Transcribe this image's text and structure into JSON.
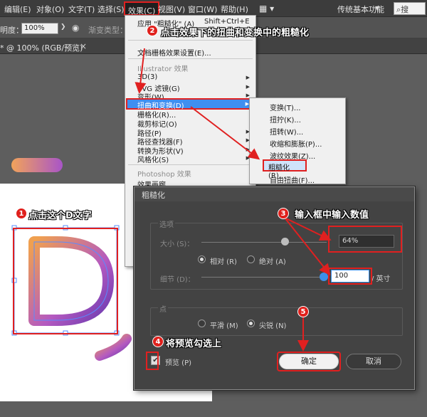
{
  "menubar": {
    "items": [
      {
        "label": "编辑(E)"
      },
      {
        "label": "对象(O)"
      },
      {
        "label": "文字(T)"
      },
      {
        "label": "选择(S)"
      },
      {
        "label": "效果(C)"
      },
      {
        "label": "视图(V)"
      },
      {
        "label": "窗口(W)"
      },
      {
        "label": "帮助(H)"
      }
    ],
    "workspace": "传统基本功能",
    "search_placeholder": "搜"
  },
  "control_bar": {
    "opacity_label": "明度：",
    "opacity_value": "100%",
    "gradient_label": "渐变类型："
  },
  "doc_tab": {
    "label": "* @ 100% (RGB/预览)",
    "close": "×"
  },
  "effect_menu": {
    "apply_label": "应用 \"粗糙化\" (A)",
    "apply_shortcut": "Shift+Ctrl+E",
    "raster_settings": "文档栅格效果设置(E)...",
    "illustrator_header": "Illustrator 效果",
    "items": [
      {
        "label": "3D(3)"
      },
      {
        "label": "SVG 滤镜(G)"
      },
      {
        "label": "变形(W)"
      },
      {
        "label": "扭曲和变换(D)"
      },
      {
        "label": "栅格化(R)..."
      },
      {
        "label": "裁剪标记(O)"
      },
      {
        "label": "路径(P)"
      },
      {
        "label": "路径查找器(F)"
      },
      {
        "label": "转换为形状(V)"
      },
      {
        "label": "风格化(S)"
      }
    ],
    "photoshop_header": "Photoshop 效果",
    "gallery": "效果画廊..."
  },
  "submenu": {
    "items": [
      {
        "label": "变换(T)..."
      },
      {
        "label": "扭拧(K)..."
      },
      {
        "label": "扭转(W)..."
      },
      {
        "label": "收缩和膨胀(P)..."
      },
      {
        "label": "波纹效果(Z)..."
      },
      {
        "label": "粗糙化(R)..."
      },
      {
        "label": "自由扭曲(F)..."
      }
    ]
  },
  "dialog": {
    "title": "粗糙化",
    "options_group": "选项",
    "size_label": "大小 (S)：",
    "size_value": "64%",
    "relative_label": "相对 (R)",
    "absolute_label": "绝对 (A)",
    "detail_label": "细节 (D)：",
    "detail_value": "100",
    "detail_unit": "/ 英寸",
    "point_group": "点",
    "smooth_label": "平滑 (M)",
    "corner_label": "尖锐 (N)",
    "preview_label": "预览 (P)",
    "ok_label": "确定",
    "cancel_label": "取消"
  },
  "annotations": {
    "step1": {
      "num": "1",
      "text": "点击这个D文字"
    },
    "step2": {
      "num": "2",
      "text": "点击效果下的扭曲和变换中的粗糙化"
    },
    "step3": {
      "num": "3",
      "text": "输入框中输入数值"
    },
    "step4": {
      "num": "4",
      "text": "将预览勾选上"
    },
    "step5": {
      "num": "5"
    }
  },
  "colors": {
    "accent_red": "#e02020",
    "menu_highlight": "#3f8ff0",
    "gradient_orange": "#f0a050",
    "gradient_purple": "#7a3fb0"
  }
}
